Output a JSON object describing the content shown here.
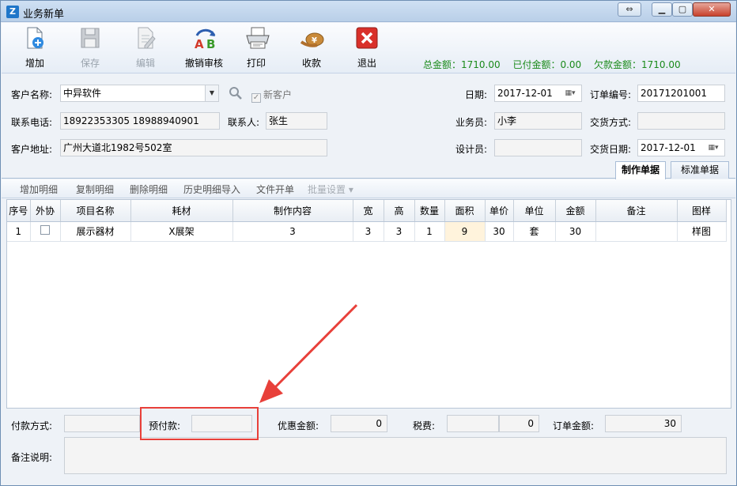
{
  "window": {
    "title": "业务新单",
    "app_icon_letter": "Z"
  },
  "toolbar": {
    "buttons": [
      {
        "label": "增加",
        "icon": "add-document-icon",
        "enabled": true
      },
      {
        "label": "保存",
        "icon": "floppy-disk-icon",
        "enabled": false
      },
      {
        "label": "编辑",
        "icon": "edit-document-icon",
        "enabled": false
      },
      {
        "label": "撤销审核",
        "icon": "ab-undo-review-icon",
        "enabled": true
      },
      {
        "label": "打印",
        "icon": "printer-icon",
        "enabled": true
      },
      {
        "label": "收款",
        "icon": "money-bag-icon",
        "enabled": true
      },
      {
        "label": "退出",
        "icon": "exit-x-icon",
        "enabled": true
      }
    ],
    "totals": {
      "total": "总金额：1710.00",
      "paid": "已付金额：0.00",
      "owed": "欠款金额：1710.00"
    }
  },
  "form": {
    "customer_label": "客户名称:",
    "customer_value": "中异软件",
    "new_customer_label": "新客户",
    "new_customer_checked": true,
    "phone_label": "联系电话:",
    "phone_value": "18922353305 18988940901",
    "contact_label": "联系人:",
    "contact_value": "张生",
    "address_label": "客户地址:",
    "address_value": "广州大道北1982号502室",
    "date_label": "日期:",
    "date_value": "2017-12-01",
    "order_no_label": "订单编号:",
    "order_no_value": "20171201001",
    "salesman_label": "业务员:",
    "salesman_value": "小李",
    "delivery_method_label": "交货方式:",
    "delivery_method_value": "",
    "designer_label": "设计员:",
    "designer_value": "",
    "delivery_date_label": "交货日期:",
    "delivery_date_value": "2017-12-01"
  },
  "tabs": [
    {
      "label": "制作单据",
      "active": true
    },
    {
      "label": "标准单据",
      "active": false
    }
  ],
  "detail_toolbar": [
    {
      "label": "增加明细",
      "enabled": true
    },
    {
      "label": "复制明细",
      "enabled": true
    },
    {
      "label": "删除明细",
      "enabled": true
    },
    {
      "label": "历史明细导入",
      "enabled": true
    },
    {
      "label": "文件开单",
      "enabled": true
    },
    {
      "label": "批量设置 ▾",
      "enabled": false
    }
  ],
  "grid": {
    "columns": [
      "序号",
      "外协",
      "项目名称",
      "耗材",
      "制作内容",
      "宽",
      "高",
      "数量",
      "面积",
      "单价",
      "单位",
      "金额",
      "备注",
      "图样"
    ],
    "rows": [
      {
        "seq": "1",
        "outsourced": false,
        "project": "展示器材",
        "material": "X展架",
        "content": "3",
        "width": "3",
        "height": "3",
        "qty": "1",
        "area": "9",
        "unit_price": "30",
        "unit": "套",
        "amount": "30",
        "remark": "",
        "pattern": "样图"
      }
    ]
  },
  "bottom": {
    "payment_method_label": "付款方式:",
    "payment_method_value": "",
    "prepay_label": "预付款:",
    "prepay_value": "",
    "discount_label": "优惠金额:",
    "discount_value": "0",
    "tax_label": "税费:",
    "tax_value_a": "",
    "tax_value_b": "0",
    "order_amount_label": "订单金额:",
    "order_amount_value": "30",
    "remark_label": "备注说明:",
    "remark_value": ""
  },
  "annotation": {
    "color": "#e8403a"
  },
  "colors": {
    "totals_green": "#1a8a1a",
    "exit_red": "#d9302a"
  }
}
